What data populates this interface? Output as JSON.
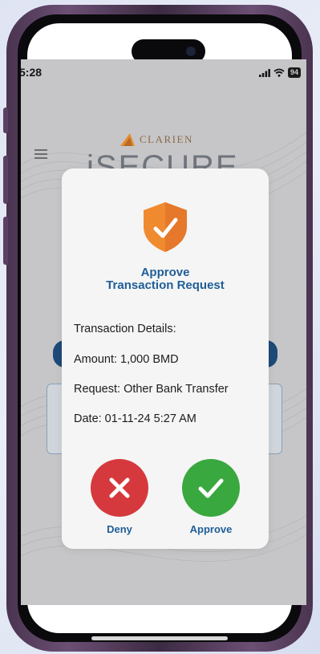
{
  "status_bar": {
    "time": "5:28",
    "battery": "94"
  },
  "header": {
    "brand_name": "CLARIEN",
    "app_name": "iSECURE"
  },
  "dialog": {
    "title_line1": "Approve",
    "title_line2": "Transaction Request",
    "details_heading": "Transaction Details:",
    "amount": "Amount: 1,000 BMD",
    "request": "Request: Other Bank Transfer",
    "date": "Date: 01-11-24 5:27 AM",
    "deny_label": "Deny",
    "approve_label": "Approve"
  },
  "colors": {
    "accent_blue": "#1f5e97",
    "shield_orange": "#f08a2f",
    "deny_red": "#d5393e",
    "approve_green": "#39a83f"
  },
  "icons": {
    "menu": "hamburger-menu-icon",
    "shield": "shield-check-icon",
    "deny": "close-x-icon",
    "approve": "checkmark-icon"
  }
}
